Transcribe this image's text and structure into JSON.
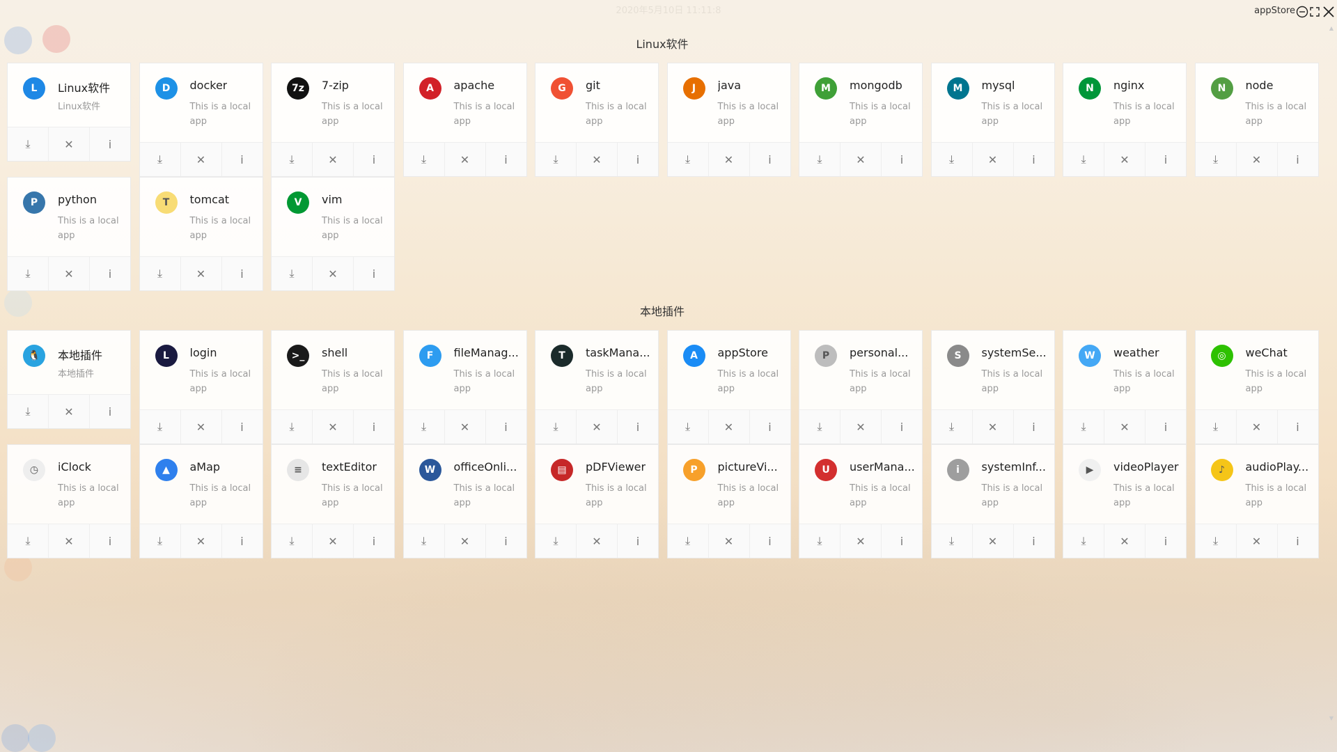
{
  "window": {
    "title": "appStore",
    "clock": "2020年5月10日 11:11:8"
  },
  "sections": [
    {
      "title": "Linux软件",
      "apps": [
        {
          "name": "Linux软件",
          "desc": "Linux软件",
          "icon": "linux-category-icon",
          "color": "#1e88e5"
        },
        {
          "name": "docker",
          "desc": "This is a local app",
          "icon": "docker-icon",
          "color": "#1d91e6"
        },
        {
          "name": "7-zip",
          "desc": "This is a local app",
          "icon": "7zip-icon",
          "color": "#111111"
        },
        {
          "name": "apache",
          "desc": "This is a local app",
          "icon": "apache-icon",
          "color": "#d22128"
        },
        {
          "name": "git",
          "desc": "This is a local app",
          "icon": "git-icon",
          "color": "#f05133"
        },
        {
          "name": "java",
          "desc": "This is a local app",
          "icon": "java-icon",
          "color": "#e76f00"
        },
        {
          "name": "mongodb",
          "desc": "This is a local app",
          "icon": "mongodb-icon",
          "color": "#3fa037"
        },
        {
          "name": "mysql",
          "desc": "This is a local app",
          "icon": "mysql-icon",
          "color": "#00758f"
        },
        {
          "name": "nginx",
          "desc": "This is a local app",
          "icon": "nginx-icon",
          "color": "#009639"
        },
        {
          "name": "node",
          "desc": "This is a local app",
          "icon": "node-icon",
          "color": "#539e43"
        },
        {
          "name": "python",
          "desc": "This is a local app",
          "icon": "python-icon",
          "color": "#3776ab"
        },
        {
          "name": "tomcat",
          "desc": "This is a local app",
          "icon": "tomcat-icon",
          "color": "#f8dc75"
        },
        {
          "name": "vim",
          "desc": "This is a local app",
          "icon": "vim-icon",
          "color": "#019833"
        }
      ]
    },
    {
      "title": "本地插件",
      "apps": [
        {
          "name": "本地插件",
          "desc": "本地插件",
          "icon": "penguin-icon",
          "color": "#29a3e0"
        },
        {
          "name": "login",
          "desc": "This is a local app",
          "icon": "login-icon",
          "color": "#1a1a40"
        },
        {
          "name": "shell",
          "desc": "This is a local app",
          "icon": "shell-icon",
          "color": "#1a1a1a"
        },
        {
          "name": "fileManag...",
          "desc": "This is a local app",
          "icon": "finder-icon",
          "color": "#2d9cf0"
        },
        {
          "name": "taskMana...",
          "desc": "This is a local app",
          "icon": "activity-monitor-icon",
          "color": "#1b2b2b"
        },
        {
          "name": "appStore",
          "desc": "This is a local app",
          "icon": "appstore-icon",
          "color": "#1a8cf5"
        },
        {
          "name": "personal...",
          "desc": "This is a local app",
          "icon": "user-avatar-icon",
          "color": "#bdbdbd"
        },
        {
          "name": "systemSe...",
          "desc": "This is a local app",
          "icon": "settings-gear-icon",
          "color": "#8a8a8a"
        },
        {
          "name": "weather",
          "desc": "This is a local app",
          "icon": "weather-icon",
          "color": "#44a8f5"
        },
        {
          "name": "weChat",
          "desc": "This is a local app",
          "icon": "wechat-icon",
          "color": "#2dc100"
        },
        {
          "name": "iClock",
          "desc": "This is a local app",
          "icon": "clock-icon",
          "color": "#eeeeee"
        },
        {
          "name": "aMap",
          "desc": "This is a local app",
          "icon": "map-icon",
          "color": "#2f80ed"
        },
        {
          "name": "textEditor",
          "desc": "This is a local app",
          "icon": "text-editor-icon",
          "color": "#e6e6e6"
        },
        {
          "name": "officeOnli...",
          "desc": "This is a local app",
          "icon": "word-icon",
          "color": "#2b579a"
        },
        {
          "name": "pDFViewer",
          "desc": "This is a local app",
          "icon": "pdf-icon",
          "color": "#c62828"
        },
        {
          "name": "pictureVi...",
          "desc": "This is a local app",
          "icon": "photos-icon",
          "color": "#f7a02a"
        },
        {
          "name": "userMana...",
          "desc": "This is a local app",
          "icon": "user-manager-icon",
          "color": "#d32f2f"
        },
        {
          "name": "systemInf...",
          "desc": "This is a local app",
          "icon": "info-icon",
          "color": "#9e9e9e"
        },
        {
          "name": "videoPlayer",
          "desc": "This is a local app",
          "icon": "play-icon",
          "color": "#f0f0f0"
        },
        {
          "name": "audioPlay...",
          "desc": "This is a local app",
          "icon": "music-icon",
          "color": "#f5c518"
        }
      ]
    }
  ],
  "actions": {
    "download": "⤓",
    "remove": "✕",
    "info": "i"
  },
  "scroll": {
    "up": "▲",
    "down": "▼"
  }
}
